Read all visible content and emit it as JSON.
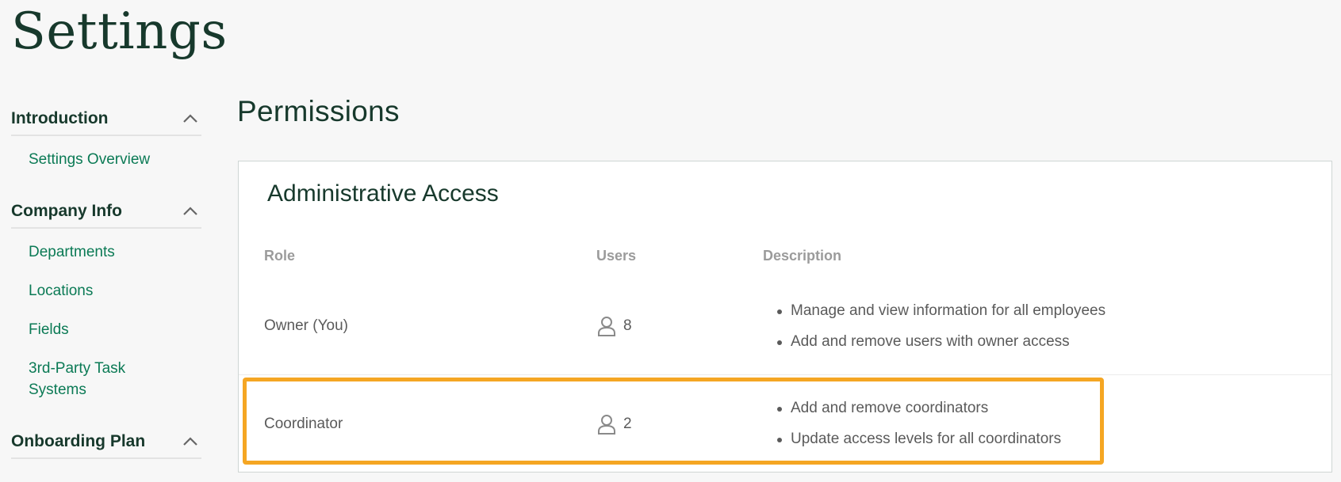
{
  "page": {
    "title": "Settings"
  },
  "sidebar": {
    "sections": [
      {
        "title": "Introduction",
        "items": [
          "Settings Overview"
        ]
      },
      {
        "title": "Company Info",
        "items": [
          "Departments",
          "Locations",
          "Fields",
          "3rd-Party Task Systems"
        ]
      },
      {
        "title": "Onboarding Plan",
        "items": []
      }
    ]
  },
  "main": {
    "title": "Permissions",
    "card": {
      "title": "Administrative Access",
      "columns": {
        "role": "Role",
        "users": "Users",
        "description": "Description"
      },
      "rows": [
        {
          "role": "Owner (You)",
          "users": "8",
          "description": [
            "Manage and view information for all employees",
            "Add and remove users with owner access"
          ],
          "highlighted": false
        },
        {
          "role": "Coordinator",
          "users": "2",
          "description": [
            "Add and remove coordinators",
            "Update access levels for all coordinators"
          ],
          "highlighted": true
        }
      ]
    }
  },
  "colors": {
    "brand_dark": "#17392c",
    "link_green": "#0b7a55",
    "highlight": "#f5a623"
  }
}
